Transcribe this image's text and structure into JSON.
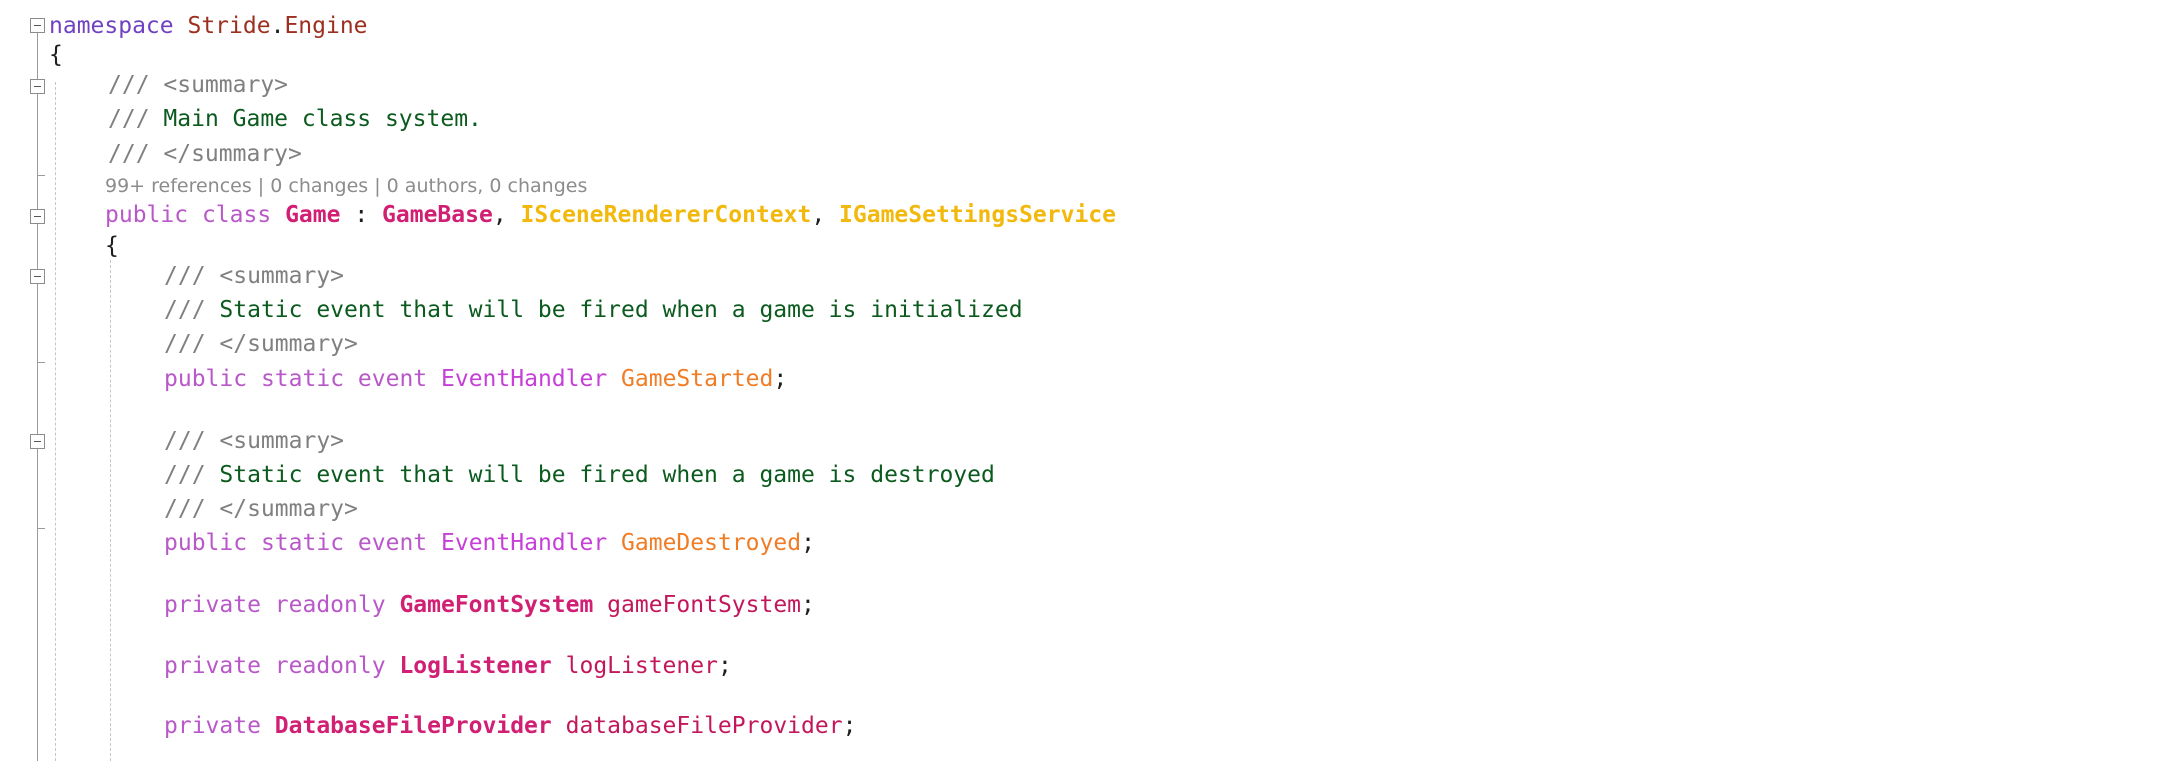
{
  "code": {
    "namespace_keyword": "namespace",
    "namespace_part1": "Stride",
    "namespace_dot": ".",
    "namespace_part2": "Engine",
    "open_brace_1": "{",
    "doc1_prefix_1": "/// <summary>",
    "doc1_slashes": "///",
    "doc1_text": "Main Game class system.",
    "doc1_close": "/// </summary>",
    "codelens": "99+ references | 0 changes | 0 authors, 0 changes",
    "class_decl": {
      "kw_public": "public",
      "kw_class": "class",
      "class_name": "Game",
      "colon": ":",
      "base": "GameBase",
      "comma1": ",",
      "iface1": "ISceneRendererContext",
      "comma2": ",",
      "iface2": "IGameSettingsService"
    },
    "open_brace_2": "{",
    "event1": {
      "doc_open": "/// <summary>",
      "doc_slashes": "///",
      "doc_text": "Static event that will be fired when a game is initialized",
      "doc_close": "/// </summary>",
      "kw_public": "public",
      "kw_static": "static",
      "kw_event": "event",
      "type": "EventHandler",
      "name": "GameStarted",
      "semicolon": ";"
    },
    "event2": {
      "doc_open": "/// <summary>",
      "doc_slashes": "///",
      "doc_text": "Static event that will be fired when a game is destroyed",
      "doc_close": "/// </summary>",
      "kw_public": "public",
      "kw_static": "static",
      "kw_event": "event",
      "type": "EventHandler",
      "name": "GameDestroyed",
      "semicolon": ";"
    },
    "field1": {
      "kw_private": "private",
      "kw_readonly": "readonly",
      "type": "GameFontSystem",
      "name": "gameFontSystem",
      "semicolon": ";"
    },
    "field2": {
      "kw_private": "private",
      "kw_readonly": "readonly",
      "type": "LogListener",
      "name": "logListener",
      "semicolon": ";"
    },
    "field3": {
      "kw_private": "private",
      "type": "DatabaseFileProvider",
      "name": "databaseFileProvider",
      "semicolon": ";"
    }
  }
}
